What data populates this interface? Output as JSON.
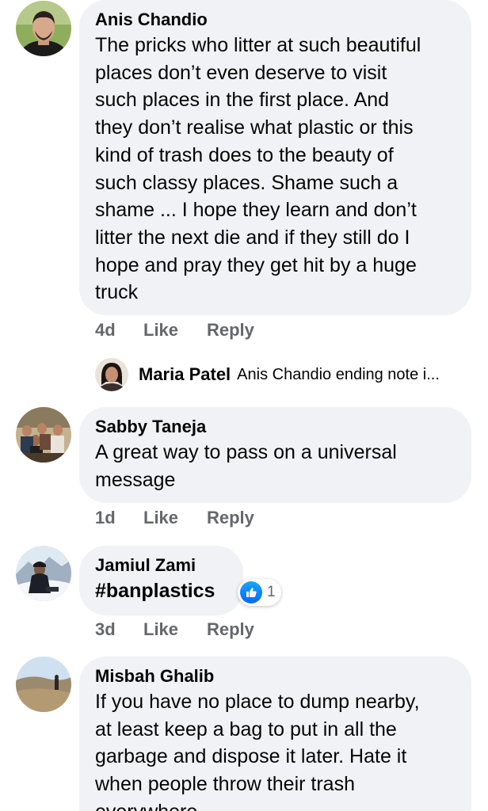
{
  "comments": [
    {
      "author": "Anis Chandio",
      "lines": [
        "The pricks who litter at such beautiful",
        "places don’t even deserve to visit",
        "such places in the first place. And",
        "they don’t realise what plastic or this",
        "kind of trash does to the beauty of",
        "such classy places. Shame such a",
        "shame ... I hope they learn and don’t",
        "litter the next die and if they still do I",
        "hope and pray they get hit by a huge",
        "truck"
      ],
      "time": "4d",
      "like_label": "Like",
      "reply_label": "Reply"
    },
    {
      "author": "Sabby Taneja",
      "lines": [
        "A great way to pass on a universal",
        "message"
      ],
      "time": "1d",
      "like_label": "Like",
      "reply_label": "Reply"
    },
    {
      "author": "Jamiul Zami",
      "lines": [
        "#banplastics"
      ],
      "time": "3d",
      "like_label": "Like",
      "reply_label": "Reply",
      "reaction": {
        "icon": "thumbs-up-icon",
        "count": "1",
        "color": "#1877f2"
      }
    },
    {
      "author": "Misbah Ghalib",
      "lines": [
        "If you have no place to dump nearby,",
        "at least keep a bag to put in all the",
        "garbage and dispose it later. Hate it",
        "when people throw their trash",
        "everywhere"
      ]
    }
  ],
  "reply_preview": {
    "author": "Maria Patel",
    "text": "Anis Chandio ending note i..."
  },
  "colors": {
    "bubble": "#f0f2f5",
    "meta_text": "#65676b",
    "like_blue": "#1877f2"
  }
}
